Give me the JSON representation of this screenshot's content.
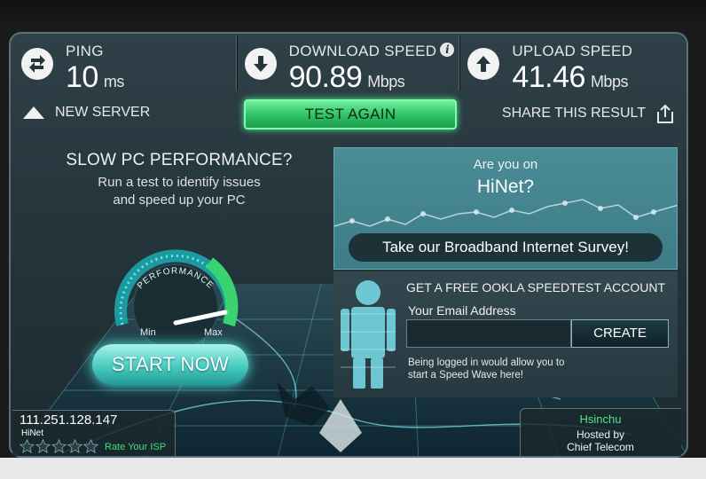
{
  "stats": {
    "ping": {
      "label": "PING",
      "value": "10",
      "unit": "ms",
      "icon": "exchange-arrows-icon"
    },
    "download": {
      "label": "DOWNLOAD SPEED",
      "value": "90.89",
      "unit": "Mbps",
      "icon": "arrow-down-icon",
      "info": "i"
    },
    "upload": {
      "label": "UPLOAD SPEED",
      "value": "41.46",
      "unit": "Mbps",
      "icon": "arrow-up-icon"
    }
  },
  "actions": {
    "new_server": "NEW SERVER",
    "test_again": "TEST AGAIN",
    "share": "SHARE THIS RESULT"
  },
  "promo": {
    "title": "SLOW PC PERFORMANCE?",
    "desc_line1": "Run a test to identify issues",
    "desc_line2": "and speed up your PC",
    "gauge_label": "PERFORMANCE",
    "gauge_min": "Min",
    "gauge_max": "Max",
    "start": "START NOW"
  },
  "survey": {
    "question_line1": "Are you on",
    "question_line2": "HiNet?",
    "button": "Take our Broadband Internet Survey!"
  },
  "account": {
    "heading": "GET A FREE OOKLA SPEEDTEST ACCOUNT",
    "email_label": "Your Email Address",
    "email_value": "",
    "create": "CREATE",
    "note_line1": "Being logged in would allow you to",
    "note_line2": "start a Speed Wave here!"
  },
  "isp": {
    "ip": "111.251.128.147",
    "name": "HiNet",
    "rate": "Rate Your ISP",
    "stars": 0
  },
  "server": {
    "city": "Hsinchu",
    "hosted_by": "Hosted by",
    "host": "Chief Telecom"
  },
  "colors": {
    "accent_green": "#3fe07c",
    "teal": "#4fd0c4",
    "panel": "#2f4048"
  }
}
